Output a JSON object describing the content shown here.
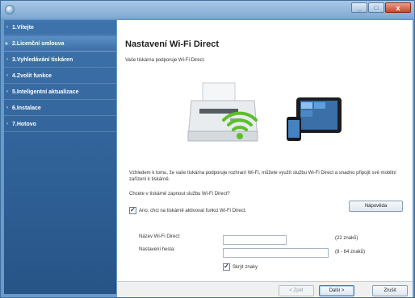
{
  "window": {
    "close_glyph": "x",
    "min_glyph": "_",
    "max_glyph": "□"
  },
  "sidebar": {
    "steps": [
      {
        "label": "1.Vítejte",
        "active": false
      },
      {
        "label": "2.Licenční smlouva",
        "active": true
      },
      {
        "label": "3.Vyhledávání tiskáren",
        "active": false
      },
      {
        "label": "4.Zvolit funkce",
        "active": false
      },
      {
        "label": "5.Inteligentní aktualizace",
        "active": false
      },
      {
        "label": "6.Instalace",
        "active": false
      },
      {
        "label": "7.Hotovo",
        "active": false
      }
    ]
  },
  "main": {
    "title": "Nastavení Wi-Fi Direct",
    "subtitle": "Vaše tiskárna podporuje Wi-Fi Direct.",
    "description": "Vzhledem k tomu, že vaše tiskárna podporuje rozhraní Wi-Fi, můžete využít službu Wi-Fi Direct a snadno připojit své mobilní zařízení k tiskárně.",
    "question": "Chcete v tiskárně zapnout službu Wi-Fi Direct?",
    "help_button": "Nápověda",
    "enable_checkbox": {
      "label": "Ano, chci na tiskárně aktivovat funkci Wi-Fi Direct.",
      "checked": true
    },
    "wifi_name": {
      "label": "Název Wi-Fi Direct:",
      "value": "",
      "hint": "(22 znaků)"
    },
    "password": {
      "label": "Nastavení hesla:",
      "value": "",
      "hint": "(8 - 64 znaků)"
    },
    "hide_chars_checkbox": {
      "label": "Skrýt znaky",
      "checked": true
    }
  },
  "footer": {
    "back": "< Zpět",
    "next": "Další >",
    "cancel": "Zrušit"
  },
  "colors": {
    "sidebar": "#2e5f95",
    "wifi_green": "#5bbf2a"
  }
}
